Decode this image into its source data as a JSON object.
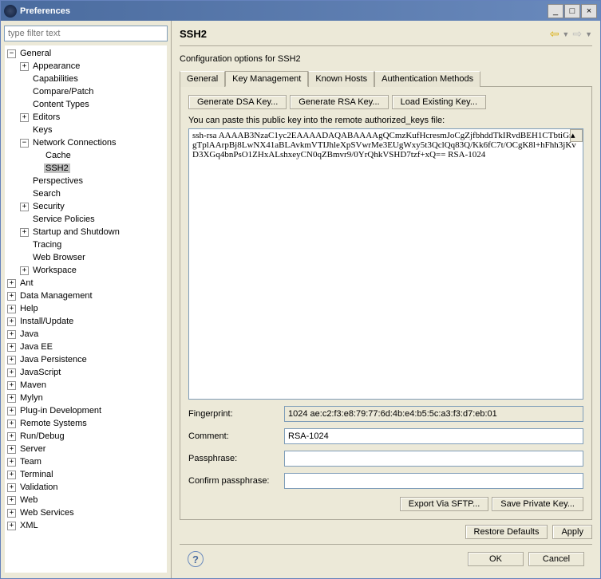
{
  "window": {
    "title": "Preferences"
  },
  "filter": {
    "placeholder": "type filter text"
  },
  "tree": {
    "items": [
      {
        "depth": 0,
        "exp": "-",
        "label": "General"
      },
      {
        "depth": 1,
        "exp": "+",
        "label": "Appearance"
      },
      {
        "depth": 1,
        "exp": "",
        "label": "Capabilities"
      },
      {
        "depth": 1,
        "exp": "",
        "label": "Compare/Patch"
      },
      {
        "depth": 1,
        "exp": "",
        "label": "Content Types"
      },
      {
        "depth": 1,
        "exp": "+",
        "label": "Editors"
      },
      {
        "depth": 1,
        "exp": "",
        "label": "Keys"
      },
      {
        "depth": 1,
        "exp": "-",
        "label": "Network Connections"
      },
      {
        "depth": 2,
        "exp": "",
        "label": "Cache"
      },
      {
        "depth": 2,
        "exp": "",
        "label": "SSH2",
        "sel": true
      },
      {
        "depth": 1,
        "exp": "",
        "label": "Perspectives"
      },
      {
        "depth": 1,
        "exp": "",
        "label": "Search"
      },
      {
        "depth": 1,
        "exp": "+",
        "label": "Security"
      },
      {
        "depth": 1,
        "exp": "",
        "label": "Service Policies"
      },
      {
        "depth": 1,
        "exp": "+",
        "label": "Startup and Shutdown"
      },
      {
        "depth": 1,
        "exp": "",
        "label": "Tracing"
      },
      {
        "depth": 1,
        "exp": "",
        "label": "Web Browser"
      },
      {
        "depth": 1,
        "exp": "+",
        "label": "Workspace"
      },
      {
        "depth": 0,
        "exp": "+",
        "label": "Ant"
      },
      {
        "depth": 0,
        "exp": "+",
        "label": "Data Management"
      },
      {
        "depth": 0,
        "exp": "+",
        "label": "Help"
      },
      {
        "depth": 0,
        "exp": "+",
        "label": "Install/Update"
      },
      {
        "depth": 0,
        "exp": "+",
        "label": "Java"
      },
      {
        "depth": 0,
        "exp": "+",
        "label": "Java EE"
      },
      {
        "depth": 0,
        "exp": "+",
        "label": "Java Persistence"
      },
      {
        "depth": 0,
        "exp": "+",
        "label": "JavaScript"
      },
      {
        "depth": 0,
        "exp": "+",
        "label": "Maven"
      },
      {
        "depth": 0,
        "exp": "+",
        "label": "Mylyn"
      },
      {
        "depth": 0,
        "exp": "+",
        "label": "Plug-in Development"
      },
      {
        "depth": 0,
        "exp": "+",
        "label": "Remote Systems"
      },
      {
        "depth": 0,
        "exp": "+",
        "label": "Run/Debug"
      },
      {
        "depth": 0,
        "exp": "+",
        "label": "Server"
      },
      {
        "depth": 0,
        "exp": "+",
        "label": "Team"
      },
      {
        "depth": 0,
        "exp": "+",
        "label": "Terminal"
      },
      {
        "depth": 0,
        "exp": "+",
        "label": "Validation"
      },
      {
        "depth": 0,
        "exp": "+",
        "label": "Web"
      },
      {
        "depth": 0,
        "exp": "+",
        "label": "Web Services"
      },
      {
        "depth": 0,
        "exp": "+",
        "label": "XML"
      }
    ]
  },
  "page": {
    "title": "SSH2",
    "desc": "Configuration options for SSH2",
    "tabs": [
      "General",
      "Key Management",
      "Known Hosts",
      "Authentication Methods"
    ],
    "activeTab": 1,
    "buttons": {
      "gen_dsa": "Generate DSA Key...",
      "gen_rsa": "Generate RSA Key...",
      "load": "Load Existing Key..."
    },
    "hint": "You can paste this public key into the remote authorized_keys file:",
    "publickey": "ssh-rsa AAAAB3NzaC1yc2EAAAADAQABAAAAgQCmzKufHcresmJoCgZjfbhddTkIRvdBEH1CTbtiGrTgTplAArpBj8LwNX41aBLAvkmVTIJhleXpSVwrMe3EUgWxy5t3QclQq83Q/Kk6fC7t/OCgK8l+hFhh3jKvD3XGq4bnPsO1ZHxALshxeyCN0qZBmvr9/0YrQhkVSHD7tzf+xQ== RSA-1024",
    "form": {
      "fingerprint_label": "Fingerprint:",
      "fingerprint": "1024 ae:c2:f3:e8:79:77:6d:4b:e4:b5:5c:a3:f3:d7:eb:01",
      "comment_label": "Comment:",
      "comment": "RSA-1024",
      "passphrase_label": "Passphrase:",
      "passphrase": "",
      "confirm_label": "Confirm passphrase:",
      "confirm": ""
    },
    "actions": {
      "export": "Export Via SFTP...",
      "save": "Save Private Key..."
    },
    "bottom": {
      "restore": "Restore Defaults",
      "apply": "Apply"
    }
  },
  "dialog": {
    "ok": "OK",
    "cancel": "Cancel"
  }
}
